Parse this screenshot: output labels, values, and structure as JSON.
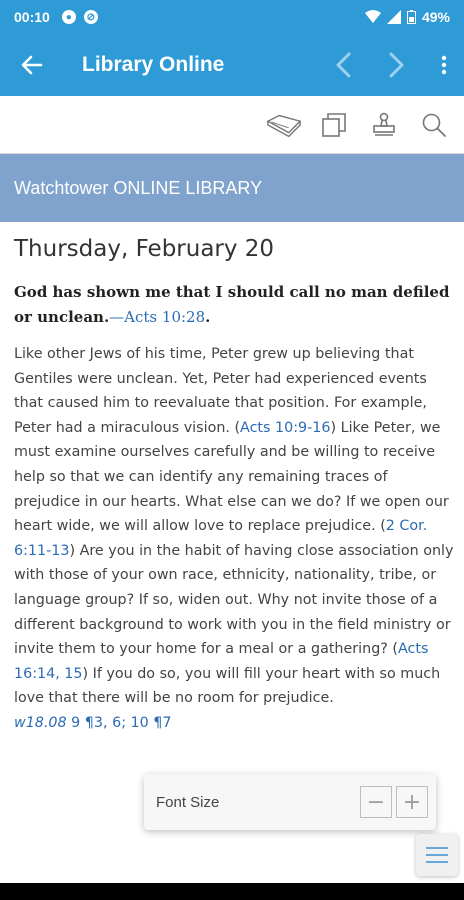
{
  "status_bar": {
    "time": "00:10",
    "battery": "49%"
  },
  "app_bar": {
    "title": "Library Online"
  },
  "icons": {
    "back": "arrow-back-icon",
    "prev": "chevron-left-icon",
    "next": "chevron-right-icon",
    "more": "more-vert-icon",
    "book": "open-book-icon",
    "copy": "copy-icon",
    "stamp": "stamp-icon",
    "search": "search-icon",
    "menu": "menu-icon"
  },
  "banner": {
    "text": "Watchtower ONLINE LIBRARY"
  },
  "article": {
    "date": "Thursday, February 20",
    "theme_text": "God has shown me that I should call no man defiled or unclean.",
    "theme_ref": "—Acts 10:28",
    "theme_end": ".",
    "p1": "Like other Jews of his time, Peter grew up believing that Gentiles were unclean. Yet, Peter had experienced events that caused him to reevaluate that position. For example, Peter had a miraculous vision. (",
    "ref1": "Acts 10:9-16",
    "p2": ") Like Peter, we must examine ourselves carefully and be willing to receive help so that we can identify any remaining traces of prejudice in our hearts. What else can we do? If we open our heart wide, we will allow love to replace prejudice. (",
    "ref2": "2 Cor. 6:11-13",
    "p3": ") Are you in the habit of having close association only with those of your own race, ethnicity, nationality, tribe, or language group? If so, widen out. Why not invite those of a different background to work with you in the field ministry or invite them to your home for a meal or a gathering? (",
    "ref3": "Acts 16:14, 15",
    "p4": ") If you do so, you will fill your heart with so much love that there will be no room for prejudice.",
    "pub_ref": "w18.08",
    "pub_pages": " 9 ¶3, 6; 10 ¶7"
  },
  "font_popup": {
    "label": "Font Size",
    "decrease": "−",
    "increase": "+"
  },
  "colors": {
    "app_bar": "#2e9bd6",
    "banner": "#7fa3cc",
    "link": "#2c6bb5"
  }
}
